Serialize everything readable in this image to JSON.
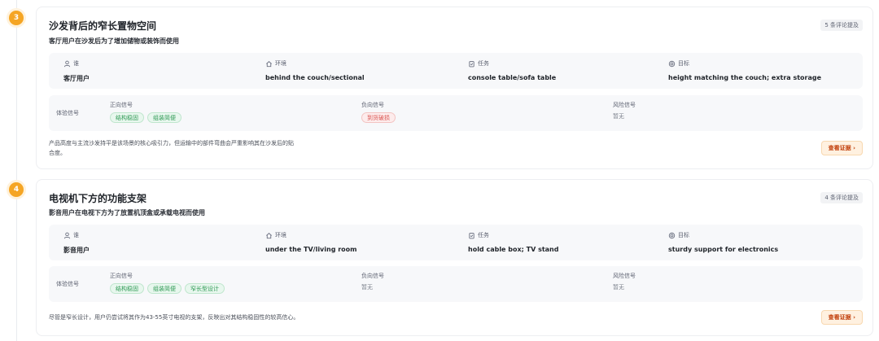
{
  "cards": [
    {
      "step": "3",
      "title": "沙发背后的窄长置物空间",
      "subtitle": "客厅用户在沙发后为了增加储物或装饰而使用",
      "mentions": "5 条评论提及",
      "info": {
        "who_label": "谁",
        "who_value": "客厅用户",
        "env_label": "环境",
        "env_value": "behind the couch/sectional",
        "task_label": "任务",
        "task_value": "console table/sofa table",
        "goal_label": "目标",
        "goal_value": "height matching the couch; extra storage"
      },
      "signals": {
        "title": "体验信号",
        "positive_label": "正向信号",
        "positive_tags": [
          "结构稳固",
          "组装简便"
        ],
        "negative_label": "负向信号",
        "negative_tags": [
          "到货破损"
        ],
        "negative_empty": "",
        "risk_label": "风险信号",
        "risk_empty": "暂无"
      },
      "summary_line1": "产品高度与主流沙发持平是该场景的核心吸引力，但运输中的部件弯曲会严重影响其在沙发后的贴",
      "summary_line2": "合度。",
      "evidence_label": "查看证据 ›"
    },
    {
      "step": "4",
      "title": "电视机下方的功能支架",
      "subtitle": "影音用户在电视下方为了放置机顶盒或承载电视而使用",
      "mentions": "4 条评论提及",
      "info": {
        "who_label": "谁",
        "who_value": "影音用户",
        "env_label": "环境",
        "env_value": "under the TV/living room",
        "task_label": "任务",
        "task_value": "hold cable box; TV stand",
        "goal_label": "目标",
        "goal_value": "sturdy support for electronics"
      },
      "signals": {
        "title": "体验信号",
        "positive_label": "正向信号",
        "positive_tags": [
          "结构稳固",
          "组装简便",
          "窄长型设计"
        ],
        "negative_label": "负向信号",
        "negative_tags": [],
        "negative_empty": "暂无",
        "risk_label": "风险信号",
        "risk_empty": "暂无"
      },
      "summary_line1": "尽管是窄长设计，用户仍尝试将其作为43-55英寸电视的支架，反映出对其结构稳固性的较高信心。",
      "summary_line2": "",
      "evidence_label": "查看证据 ›"
    }
  ],
  "colors": {
    "step_badge": "#f5a524",
    "positive_tag": "#2f9a55",
    "negative_tag": "#d9534f",
    "evidence_button": "#c2410c"
  },
  "icons": {
    "who": "user-icon",
    "env": "home-icon",
    "task": "clipboard-icon",
    "goal": "target-icon"
  }
}
